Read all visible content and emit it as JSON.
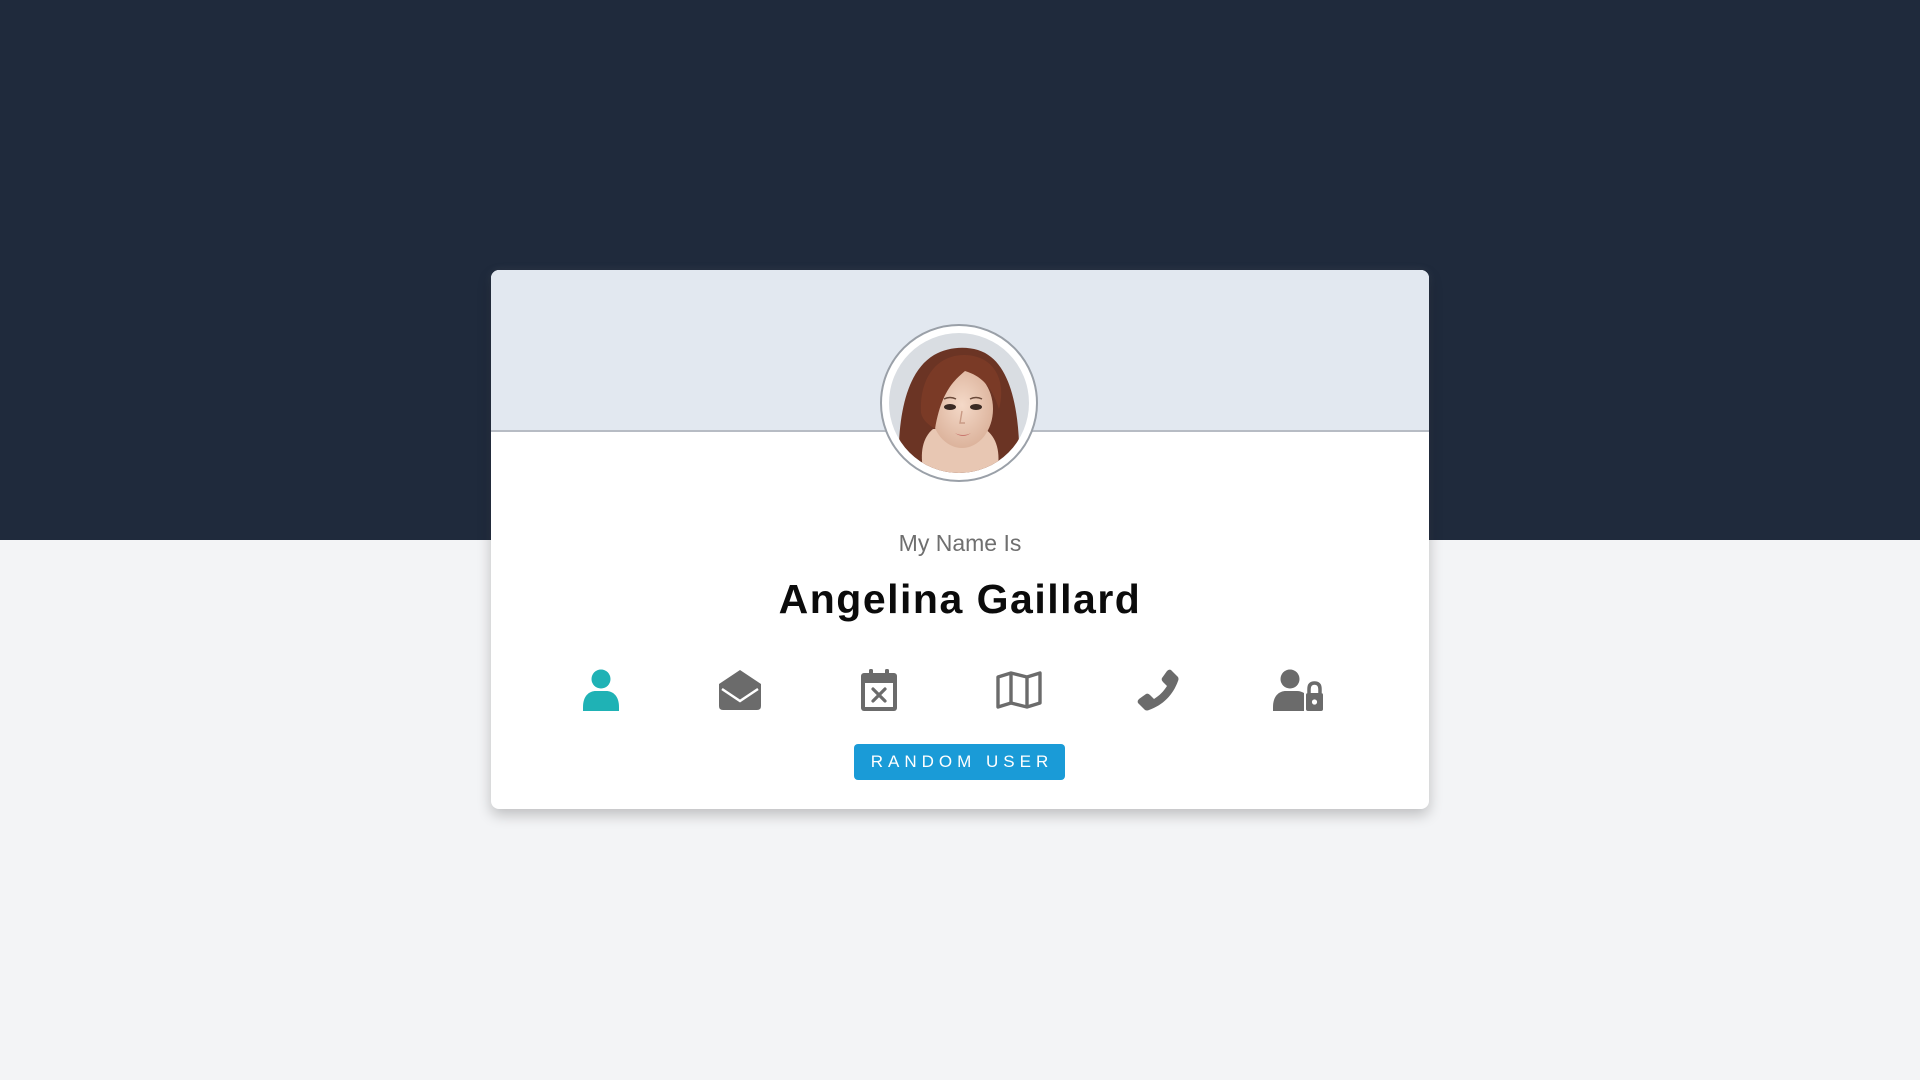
{
  "profile": {
    "subtitle": "My Name Is",
    "name": "Angelina Gaillard"
  },
  "icons": [
    {
      "name": "user-icon",
      "active": true
    },
    {
      "name": "envelope-open-icon",
      "active": false
    },
    {
      "name": "calendar-x-icon",
      "active": false
    },
    {
      "name": "map-icon",
      "active": false
    },
    {
      "name": "phone-icon",
      "active": false
    },
    {
      "name": "user-lock-icon",
      "active": false
    }
  ],
  "button": {
    "label": "RANDOM USER"
  },
  "colors": {
    "background_top": "#1f2a3c",
    "background_bottom": "#f3f4f6",
    "card_header": "#e2e8f0",
    "icon_active": "#1fb2b5",
    "icon_inactive": "#6b6b6b",
    "button": "#1a9bd7"
  }
}
